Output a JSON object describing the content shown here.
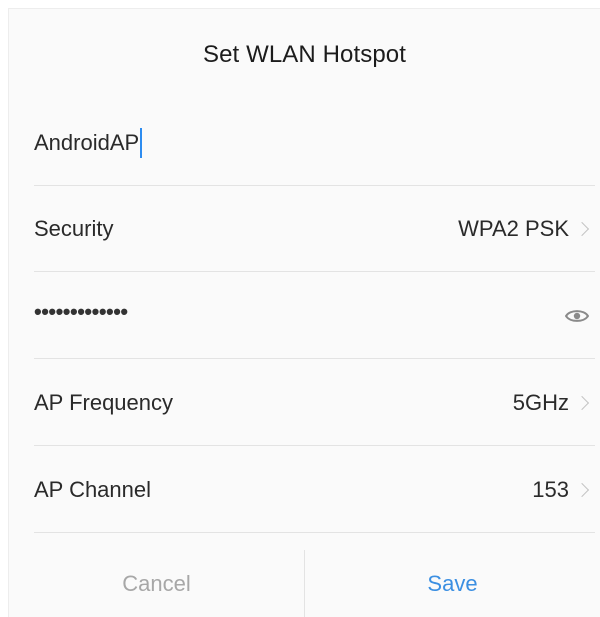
{
  "dialog": {
    "title": "Set WLAN Hotspot"
  },
  "ssid": {
    "value": "AndroidAP"
  },
  "security": {
    "label": "Security",
    "value": "WPA2 PSK"
  },
  "password": {
    "masked_value": "•••••••••••••",
    "toggle_icon": "eye-icon"
  },
  "frequency": {
    "label": "AP Frequency",
    "value": "5GHz"
  },
  "channel": {
    "label": "AP Channel",
    "value": "153"
  },
  "buttons": {
    "cancel_label": "Cancel",
    "save_label": "Save"
  },
  "colors": {
    "accent": "#3b8fe2",
    "disabled_text": "#a7a7a7",
    "caret": "#2d8cf0"
  }
}
